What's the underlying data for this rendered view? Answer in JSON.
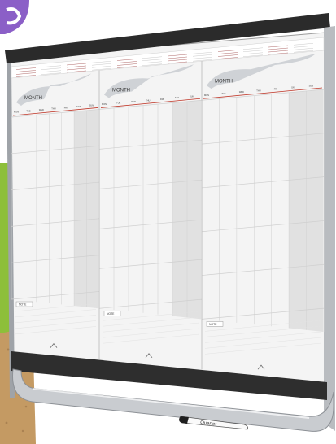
{
  "photo": {
    "subject": "three-month planning whiteboard with marker tray",
    "colors": {
      "corner_accent": "#8b5fc7",
      "cork": "#c49a63",
      "green_panel": "#8dbf3a",
      "frame_dark": "#2b2b2b",
      "frame_silver": "#b9bcc0",
      "board": "#f4f4f4",
      "weekend_column": "#e1e1e1",
      "red_rule": "#c0392b"
    }
  },
  "board": {
    "month_labels": [
      "MONTH",
      "MONTH",
      "MONTH"
    ],
    "note_labels": [
      "NOTE",
      "NOTE",
      "NOTE"
    ],
    "weekday_labels": [
      "MON",
      "TUE",
      "WED",
      "THU",
      "FRI",
      "SAT",
      "SUN"
    ],
    "brand": "Quartet"
  }
}
